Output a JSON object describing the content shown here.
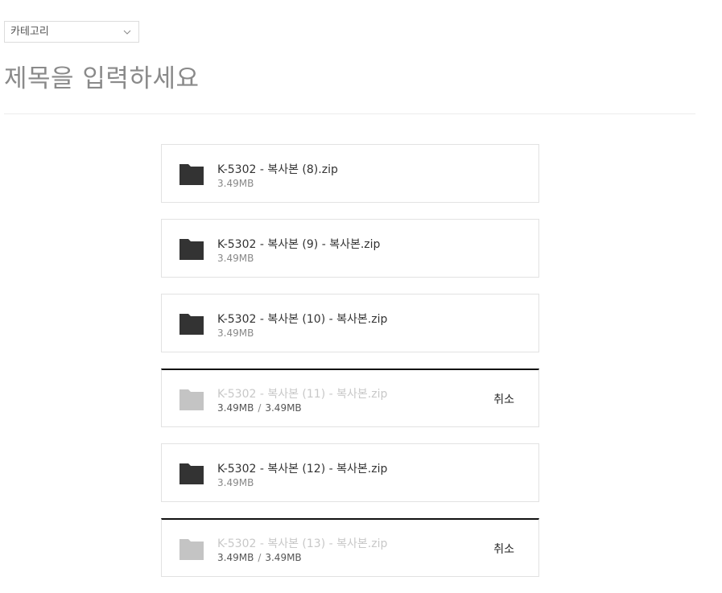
{
  "category": {
    "placeholder": "카테고리",
    "icon": "chevron-down-icon"
  },
  "title": {
    "placeholder": "제목을 입력하세요"
  },
  "files": [
    {
      "name": "K-5302 - 복사본 (8).zip",
      "size": "3.49MB",
      "status": "done"
    },
    {
      "name": "K-5302 - 복사본 (9) - 복사본.zip",
      "size": "3.49MB",
      "status": "done"
    },
    {
      "name": "K-5302 - 복사본 (10) - 복사본.zip",
      "size": "3.49MB",
      "status": "done"
    },
    {
      "name": "K-5302 - 복사본 (11) - 복사본.zip",
      "size": "3.49MB",
      "uploaded": "3.49MB",
      "total": "3.49MB",
      "status": "uploading",
      "cancel_label": "취소"
    },
    {
      "name": "K-5302 - 복사본 (12) - 복사본.zip",
      "size": "3.49MB",
      "status": "done"
    },
    {
      "name": "K-5302 - 복사본 (13) - 복사본.zip",
      "size": "3.49MB",
      "uploaded": "3.49MB",
      "total": "3.49MB",
      "status": "uploading",
      "cancel_label": "취소"
    }
  ],
  "colors": {
    "folder_done": "#333333",
    "folder_uploading": "#c4c4c4",
    "progress_line": "#111111"
  }
}
